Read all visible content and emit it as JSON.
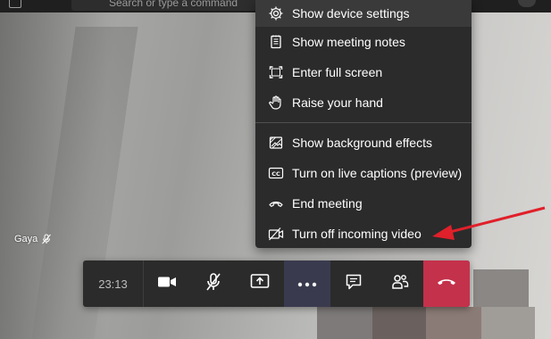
{
  "search": {
    "placeholder": "Search or type a command"
  },
  "participant": {
    "name": "Gaya"
  },
  "menu": {
    "items": [
      {
        "label": "Show device settings",
        "icon": "gear-icon"
      },
      {
        "label": "Show meeting notes",
        "icon": "notes-icon"
      },
      {
        "label": "Enter full screen",
        "icon": "fullscreen-icon"
      },
      {
        "label": "Raise your hand",
        "icon": "hand-icon"
      },
      {
        "label": "Show background effects",
        "icon": "background-effects-icon"
      },
      {
        "label": "Turn on live captions (preview)",
        "icon": "captions-icon"
      },
      {
        "label": "End meeting",
        "icon": "end-meeting-icon"
      },
      {
        "label": "Turn off incoming video",
        "icon": "video-off-icon"
      }
    ]
  },
  "controls": {
    "timer": "23:13",
    "buttons": [
      "camera-icon",
      "mic-off-icon",
      "share-icon",
      "more-icon",
      "chat-icon",
      "participants-icon",
      "hangup-icon"
    ]
  },
  "colors": {
    "menu_bg": "#2b2b2b",
    "hangup": "#c4314b",
    "more_active": "#3a3a4e",
    "arrow": "#e0202a"
  }
}
